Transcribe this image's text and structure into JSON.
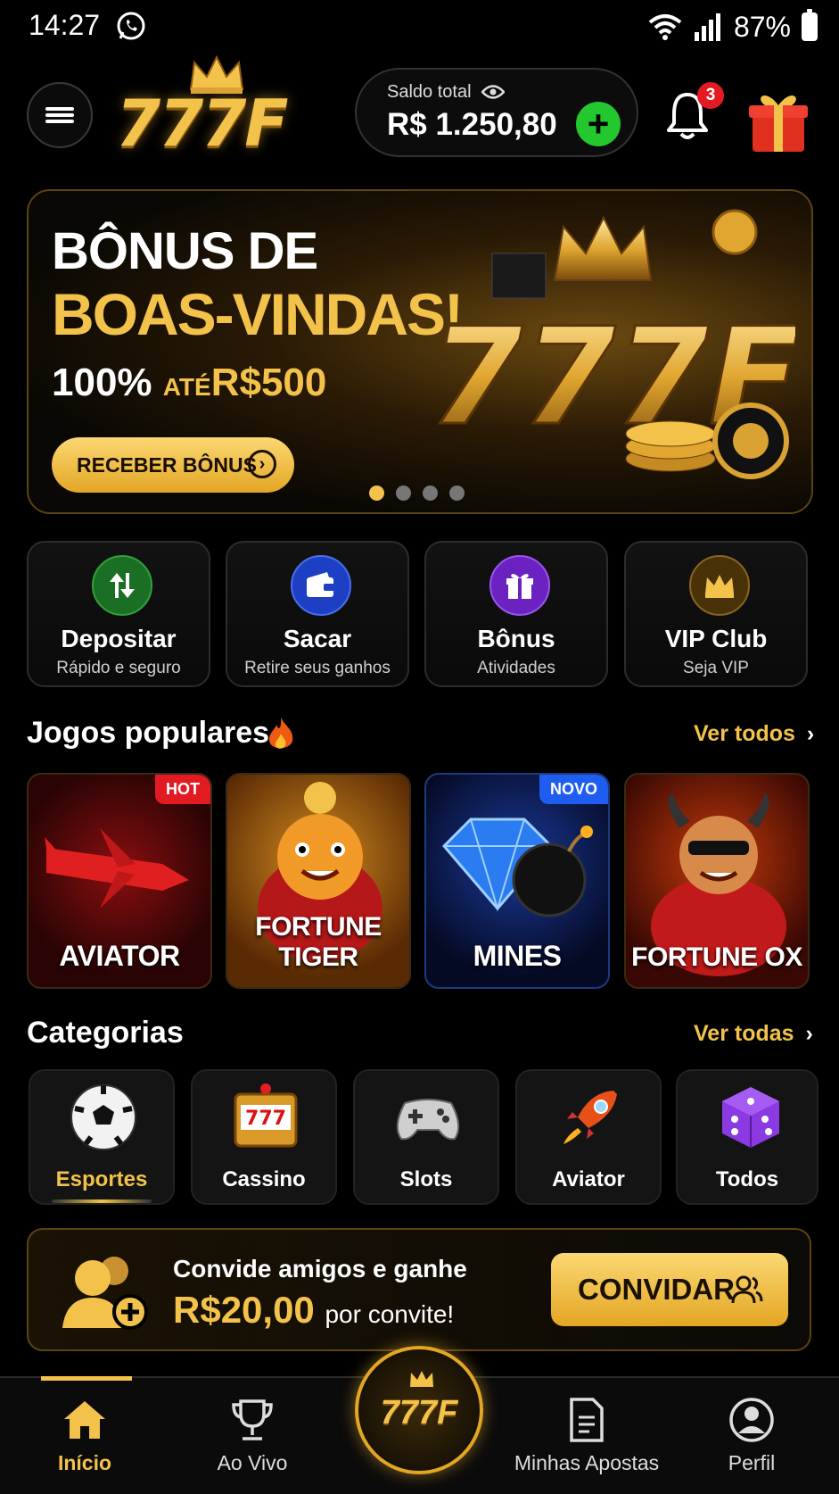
{
  "status_bar": {
    "time": "14:27",
    "battery": "87%"
  },
  "header": {
    "logo_text": "777F",
    "balance_label": "Saldo total",
    "balance_amount": "R$ 1.250,80",
    "notifications_count": "3"
  },
  "banner": {
    "line1": "BÔNUS DE",
    "line2": "BOAS-VINDAS!",
    "line3_pct": "100%",
    "line3_ate": "ATÉ",
    "line3_amount": "R$500",
    "cta": "RECEBER BÔNUS",
    "art_text": "777F",
    "slides": 4,
    "active_slide": 1
  },
  "quick_actions": [
    {
      "name": "Depositar",
      "sub": "Rápido e seguro",
      "color": "#1f8a2a"
    },
    {
      "name": "Sacar",
      "sub": "Retire seus ganhos",
      "color": "#2a4fd6"
    },
    {
      "name": "Bônus",
      "sub": "Atividades",
      "color": "#7b2fd1"
    },
    {
      "name": "VIP Club",
      "sub": "Seja VIP",
      "color": "#6a4a12"
    }
  ],
  "popular": {
    "title": "Jogos populares",
    "see_all": "Ver todos",
    "games": [
      {
        "name": "AVIATOR",
        "tag": "HOT"
      },
      {
        "name": "FORTUNE TIGER",
        "tag": ""
      },
      {
        "name": "MINES",
        "tag": "NOVO"
      },
      {
        "name": "FORTUNE OX",
        "tag": ""
      }
    ]
  },
  "categories": {
    "title": "Categorias",
    "see_all": "Ver todas",
    "items": [
      {
        "name": "Esportes",
        "icon": "soccer-ball-icon",
        "active": true
      },
      {
        "name": "Cassino",
        "icon": "slot-machine-icon",
        "active": false
      },
      {
        "name": "Slots",
        "icon": "gamepad-icon",
        "active": false
      },
      {
        "name": "Aviator",
        "icon": "rocket-icon",
        "active": false
      },
      {
        "name": "Todos",
        "icon": "dice-icon",
        "active": false
      }
    ]
  },
  "invite": {
    "line1": "Convide amigos e ganhe",
    "amount": "R$20,00",
    "suffix": "por convite!",
    "button": "CONVIDAR"
  },
  "nav": {
    "items": [
      "Início",
      "Ao Vivo",
      "Minhas Apostas",
      "Perfil"
    ],
    "center": "777F",
    "active": "Início"
  },
  "colors": {
    "gold": "#f2c24a",
    "green": "#23c72e",
    "red": "#e21b23",
    "bg": "#000000"
  }
}
